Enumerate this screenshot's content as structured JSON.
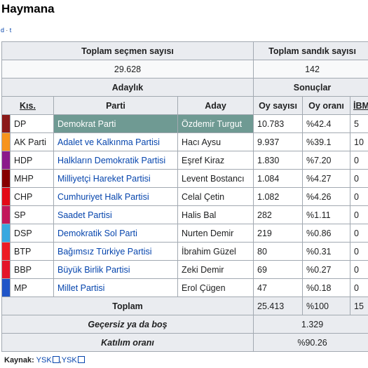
{
  "page": {
    "title": "Haymana",
    "nav": [
      "d",
      "t"
    ]
  },
  "summary": {
    "voters_label": "Toplam seçmen sayısı",
    "boxes_label": "Toplam sandık sayısı",
    "voters_value": "29.628",
    "boxes_value": "142"
  },
  "headers": {
    "candidacy": "Adaylık",
    "results": "Sonuçlar",
    "abbr": "Kıs.",
    "party": "Parti",
    "candidate": "Aday",
    "votes": "Oy sayısı",
    "pct": "Oy oranı",
    "ibm": "İBM"
  },
  "rows": [
    {
      "color": "#8b1a1a",
      "abbr": "DP",
      "party": "Demokrat Parti",
      "candidate": "Özdemir Turgut",
      "votes": "10.783",
      "pct": "%42.4",
      "ibm": "5"
    },
    {
      "color": "#f7941d",
      "abbr": "AK Parti",
      "party": "Adalet ve Kalkınma Partisi",
      "candidate": "Hacı Aysu",
      "votes": "9.937",
      "pct": "%39.1",
      "ibm": "10"
    },
    {
      "color": "#8b1a8b",
      "abbr": "HDP",
      "party": "Halkların Demokratik Partisi",
      "candidate": "Eşref Kiraz",
      "votes": "1.830",
      "pct": "%7.20",
      "ibm": "0"
    },
    {
      "color": "#870000",
      "abbr": "MHP",
      "party": "Milliyetçi Hareket Partisi",
      "candidate": "Levent Bostancı",
      "votes": "1.084",
      "pct": "%4.27",
      "ibm": "0"
    },
    {
      "color": "#e30a17",
      "abbr": "CHP",
      "party": "Cumhuriyet Halk Partisi",
      "candidate": "Celal Çetin",
      "votes": "1.082",
      "pct": "%4.26",
      "ibm": "0"
    },
    {
      "color": "#c2185b",
      "abbr": "SP",
      "party": "Saadet Partisi",
      "candidate": "Halis Bal",
      "votes": "282",
      "pct": "%1.11",
      "ibm": "0"
    },
    {
      "color": "#38a8e0",
      "abbr": "DSP",
      "party": "Demokratik Sol Parti",
      "candidate": "Nurten Demir",
      "votes": "219",
      "pct": "%0.86",
      "ibm": "0"
    },
    {
      "color": "#ed1c24",
      "abbr": "BTP",
      "party": "Bağımsız Türkiye Partisi",
      "candidate": "İbrahim Güzel",
      "votes": "80",
      "pct": "%0.31",
      "ibm": "0"
    },
    {
      "color": "#e4152a",
      "abbr": "BBP",
      "party": "Büyük Birlik Partisi",
      "candidate": "Zeki Demir",
      "votes": "69",
      "pct": "%0.27",
      "ibm": "0"
    },
    {
      "color": "#2055c8",
      "abbr": "MP",
      "party": "Millet Partisi",
      "candidate": "Erol Çügen",
      "votes": "47",
      "pct": "%0.18",
      "ibm": "0"
    }
  ],
  "totals": {
    "label": "Toplam",
    "votes": "25.413",
    "pct": "%100",
    "ibm": "15"
  },
  "invalid": {
    "label": "Geçersiz ya da boş",
    "value": "1.329"
  },
  "turnout": {
    "label": "Katılım oranı",
    "value": "%90.26"
  },
  "source": {
    "label": "Kaynak:",
    "links": [
      "YSK",
      "YSK"
    ]
  }
}
